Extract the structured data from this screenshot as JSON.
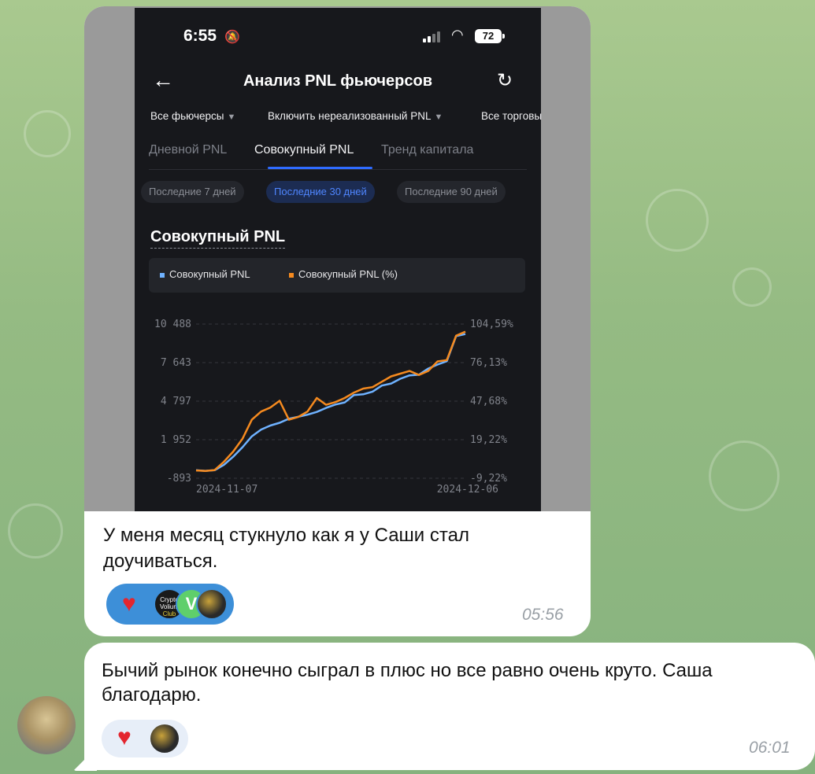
{
  "message1": {
    "screenshot": {
      "status": {
        "time": "6:55",
        "battery": "72"
      },
      "nav": {
        "title": "Анализ PNL фьючерсов"
      },
      "filters": [
        "Все фьючерсы",
        "Включить нереализованный PNL",
        "Все торговы"
      ],
      "tabs": [
        "Дневной PNL",
        "Совокупный PNL",
        "Тренд капитала"
      ],
      "active_tab": 1,
      "ranges": [
        "Последние 7 дней",
        "Последние 30 дней",
        "Последние 90 дней"
      ],
      "active_range": 1,
      "section_title": "Совокупный PNL",
      "legend": [
        "Совокупный PNL",
        "Совокупный PNL (%)"
      ],
      "colors": {
        "series_blue": "#6fb2ff",
        "series_orange": "#f58a1f",
        "accent": "#2f6bff"
      }
    },
    "caption": "У меня месяц стукнуло как я у Саши стал доучиваться.",
    "reactions": {
      "avatar_text": [
        "Crypto",
        "Volium",
        "Club"
      ],
      "avatar_letter": "V"
    },
    "time": "05:56"
  },
  "message2": {
    "caption": "Бычий рынок конечно сыграл в плюс но все равно очень круто. Саша благодарю.",
    "time": "06:01"
  },
  "chart_data": {
    "type": "line",
    "title": "Совокупный PNL",
    "x_start": "2024-11-07",
    "x_end": "2024-12-06",
    "x_tick_labels": [
      "2024-11-07",
      "2024-12-06"
    ],
    "y_left_ticks": [
      "10 488",
      "7 643",
      "4 797",
      "1 952",
      "-893"
    ],
    "y_right_ticks": [
      "104,59%",
      "76,13%",
      "47,68%",
      "19,22%",
      "-9,22%"
    ],
    "y_left_range": [
      -893,
      10488
    ],
    "y_right_range": [
      -9.22,
      104.59
    ],
    "grid": "dashed horizontal",
    "legend_placement": "top",
    "series": [
      {
        "name": "Совокупный PNL",
        "axis": "left",
        "color": "#6fb2ff",
        "values": [
          -300,
          -350,
          -300,
          100,
          700,
          1400,
          2200,
          2700,
          3000,
          3200,
          3500,
          3650,
          3800,
          4000,
          4300,
          4550,
          4700,
          5250,
          5300,
          5500,
          5950,
          6100,
          6450,
          6700,
          6750,
          7200,
          7500,
          7750,
          9600,
          9750
        ]
      },
      {
        "name": "Совокупный PNL (%)",
        "axis": "right",
        "color": "#f58a1f",
        "values": [
          -3.5,
          -3.8,
          -3.2,
          3,
          10.5,
          20,
          34,
          40,
          43,
          48,
          34,
          36,
          40,
          50,
          45,
          47,
          50,
          54,
          57,
          58,
          62,
          66,
          68,
          70,
          67,
          70,
          77,
          78,
          96,
          99
        ]
      }
    ]
  }
}
